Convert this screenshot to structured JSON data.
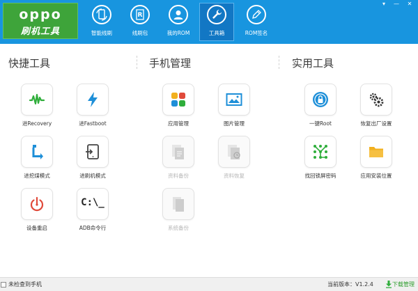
{
  "header": {
    "logo_text": "oppo",
    "logo_subtitle": "刷机工具",
    "nav": [
      {
        "label": "智能线刷",
        "icon": "phone-refresh-icon",
        "active": false
      },
      {
        "label": "线刷包",
        "icon": "package-r-icon",
        "active": false
      },
      {
        "label": "我的ROM",
        "icon": "user-icon",
        "active": false
      },
      {
        "label": "工具箱",
        "icon": "wrench-icon",
        "active": true
      },
      {
        "label": "ROM签名",
        "icon": "pen-sign-icon",
        "active": false
      }
    ],
    "window_controls": [
      "▾",
      "—",
      "✕"
    ]
  },
  "sections": [
    {
      "title": "快捷工具"
    },
    {
      "title": "手机管理"
    },
    {
      "title": "实用工具"
    }
  ],
  "tools": {
    "recovery": {
      "label": "进Recovery",
      "icon": "signal-wave-icon",
      "color": "#2fae3b",
      "enabled": true
    },
    "fastboot": {
      "label": "进Fastboot",
      "icon": "lightning-icon",
      "color": "#1e8fd8",
      "enabled": true
    },
    "download_mode": {
      "label": "进挖煤模式",
      "icon": "usb-arrow-icon",
      "color": "#1e8fd8",
      "enabled": true
    },
    "flash_mode": {
      "label": "进刷机模式",
      "icon": "tablet-enter-icon",
      "color": "#444444",
      "enabled": true
    },
    "reboot": {
      "label": "设备重启",
      "icon": "power-restart-icon",
      "color": "#e04a3a",
      "enabled": true
    },
    "adb": {
      "label": "ADB命令行",
      "icon": "terminal-icon",
      "text": "C:\\_",
      "color": "#222222",
      "enabled": true
    },
    "app_manage": {
      "label": "应用管理",
      "icon": "app-grid-icon",
      "enabled": true
    },
    "photo_manage": {
      "label": "图片管理",
      "icon": "picture-icon",
      "color": "#1e8fd8",
      "enabled": true
    },
    "data_backup": {
      "label": "资料备份",
      "icon": "document-icon",
      "enabled": false
    },
    "data_restore": {
      "label": "资料恢复",
      "icon": "document-restore-icon",
      "enabled": false
    },
    "system_backup": {
      "label": "系统备份",
      "icon": "copy-icon",
      "enabled": false
    },
    "root": {
      "label": "一键Root",
      "icon": "lock-icon",
      "color": "#1e8fd8",
      "enabled": true
    },
    "factory_reset": {
      "label": "恢复出厂设置",
      "icon": "gears-icon",
      "color": "#333333",
      "enabled": true
    },
    "unlock_pattern": {
      "label": "找回锁屏密码",
      "icon": "pattern-lock-icon",
      "color": "#2fae3b",
      "enabled": true
    },
    "app_install_location": {
      "label": "应用安装位置",
      "icon": "folder-icon",
      "color": "#f2b01e",
      "enabled": true
    }
  },
  "status": {
    "device_text": "未检查到手机",
    "version_text": "当前版本：V1.2.4",
    "download_text": "下载管理"
  }
}
